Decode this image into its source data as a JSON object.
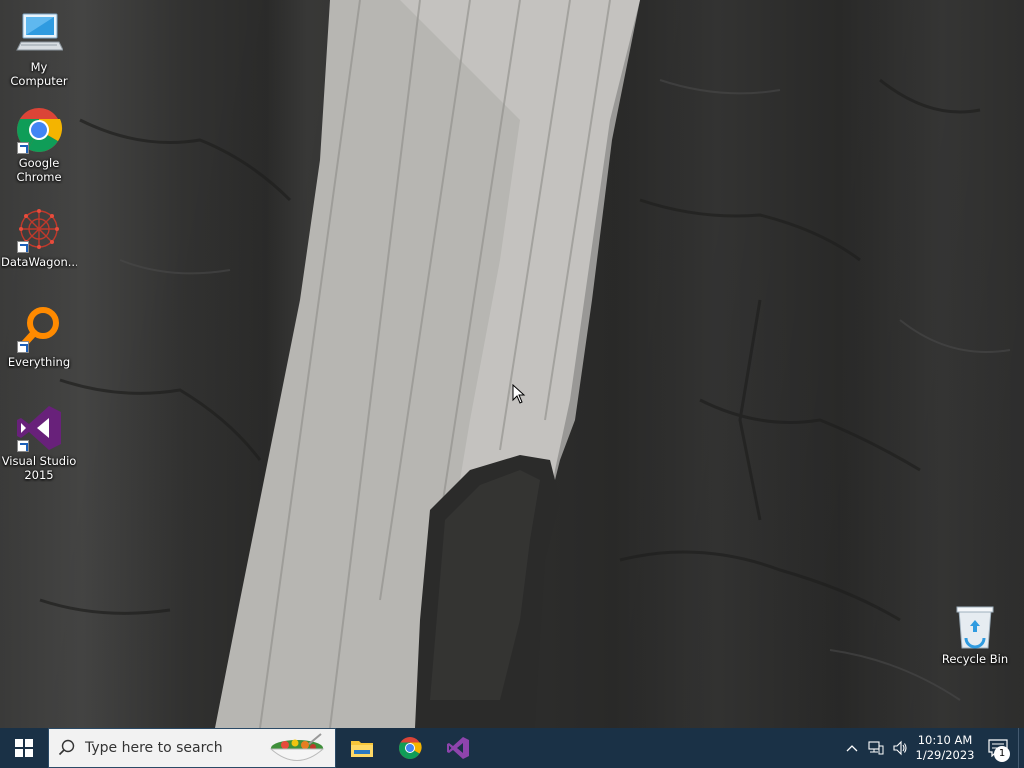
{
  "desktop": {
    "icons": [
      {
        "label": "My Computer",
        "icon": "computer-icon"
      },
      {
        "label": "Google Chrome",
        "icon": "chrome-icon"
      },
      {
        "label": "DataWagon...",
        "icon": "datawagon-icon"
      },
      {
        "label": "Everything",
        "icon": "everything-search-icon"
      },
      {
        "label": "Visual Studio 2015",
        "icon": "visual-studio-icon"
      },
      {
        "label": "Recycle Bin",
        "icon": "recycle-bin-icon"
      }
    ]
  },
  "taskbar": {
    "search_placeholder": "Type here to search",
    "pinned_apps": [
      {
        "icon": "file-explorer-icon"
      },
      {
        "icon": "chrome-icon"
      },
      {
        "icon": "visual-studio-icon"
      }
    ],
    "clock": {
      "time": "10:10 AM",
      "date": "1/29/2023"
    },
    "notification_count": "1"
  },
  "colors": {
    "taskbar": "#1a3146",
    "search_box": "#f2f2f2",
    "chrome_red": "#db4437",
    "chrome_yellow": "#f4b400",
    "chrome_green": "#0f9d58",
    "chrome_blue": "#4285f4",
    "vs_purple": "#68217a",
    "everything_orange": "#ff8a00"
  }
}
